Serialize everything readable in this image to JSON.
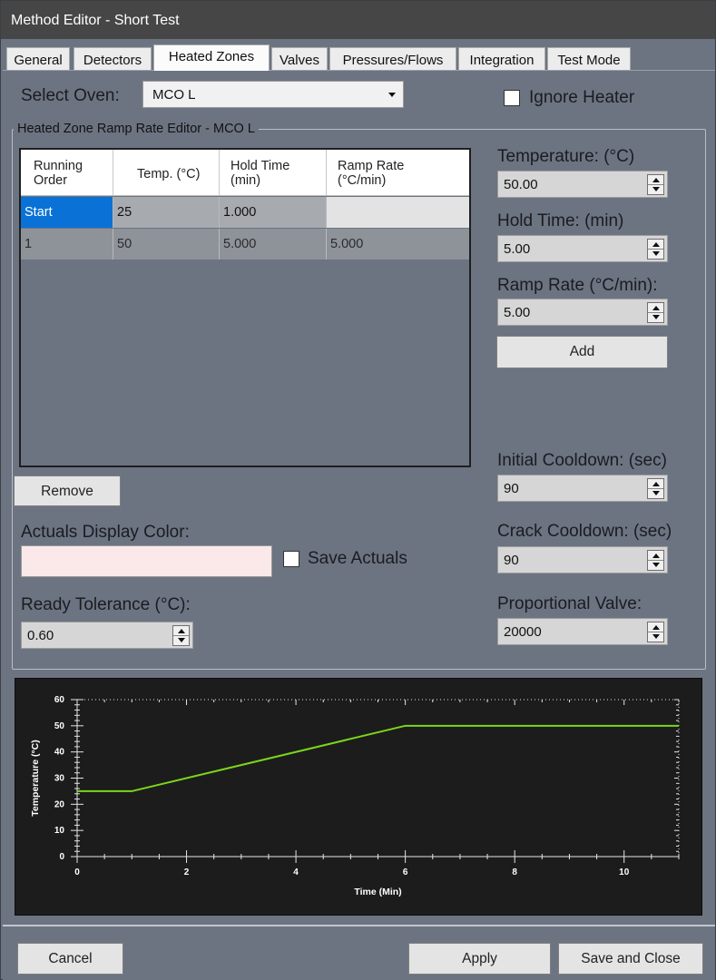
{
  "window": {
    "title": "Method Editor - Short Test"
  },
  "tabs": [
    {
      "label": "General"
    },
    {
      "label": "Detectors"
    },
    {
      "label": "Heated Zones"
    },
    {
      "label": "Valves"
    },
    {
      "label": "Pressures/Flows"
    },
    {
      "label": "Integration"
    },
    {
      "label": "Test Mode"
    }
  ],
  "active_tab": "Heated Zones",
  "oven": {
    "label": "Select Oven:",
    "value": "MCO L"
  },
  "ignore_heater": {
    "label": "Ignore Heater",
    "checked": false
  },
  "group_title": "Heated Zone Ramp Rate Editor - MCO L",
  "table": {
    "columns": [
      {
        "line1": "Running",
        "line2": "Order"
      },
      {
        "line1": "Temp. (°C)",
        "line2": ""
      },
      {
        "line1": "Hold Time",
        "line2": "(min)"
      },
      {
        "line1": "Ramp Rate",
        "line2": "(°C/min)"
      }
    ],
    "rows": [
      [
        "Start",
        "25",
        "1.000",
        ""
      ],
      [
        "1",
        "50",
        "5.000",
        "5.000"
      ]
    ]
  },
  "inputs": {
    "temperature": {
      "label": "Temperature: (°C)",
      "value": "50.00"
    },
    "hold_time": {
      "label": "Hold Time: (min)",
      "value": "5.00"
    },
    "ramp_rate": {
      "label": "Ramp Rate (°C/min):",
      "value": "5.00"
    },
    "initial_cooldown": {
      "label": "Initial Cooldown: (sec)",
      "value": "90"
    },
    "crack_cooldown": {
      "label": "Crack Cooldown: (sec)",
      "value": "90"
    },
    "proportional_valve": {
      "label": "Proportional Valve:",
      "value": "20000"
    },
    "ready_tolerance": {
      "label": "Ready Tolerance (°C):",
      "value": "0.60"
    }
  },
  "buttons": {
    "add": "Add",
    "remove": "Remove",
    "cancel": "Cancel",
    "apply": "Apply",
    "save_close": "Save and Close"
  },
  "actuals": {
    "color_label": "Actuals Display Color:",
    "color_value": "#fbe9ea",
    "save_label": "Save Actuals",
    "save_checked": false
  },
  "chart_data": {
    "type": "line",
    "title": "",
    "xlabel": "Time (Min)",
    "ylabel": "Temperature (°C)",
    "xlim": [
      0,
      11
    ],
    "ylim": [
      0,
      60
    ],
    "x_ticks": [
      0,
      2,
      4,
      6,
      8,
      10
    ],
    "y_ticks": [
      0,
      10,
      20,
      30,
      40,
      50,
      60
    ],
    "grid": false,
    "series": [
      {
        "color": "#7cd61a",
        "x": [
          0,
          1,
          6,
          11
        ],
        "y": [
          25,
          25,
          50,
          50
        ]
      }
    ]
  }
}
